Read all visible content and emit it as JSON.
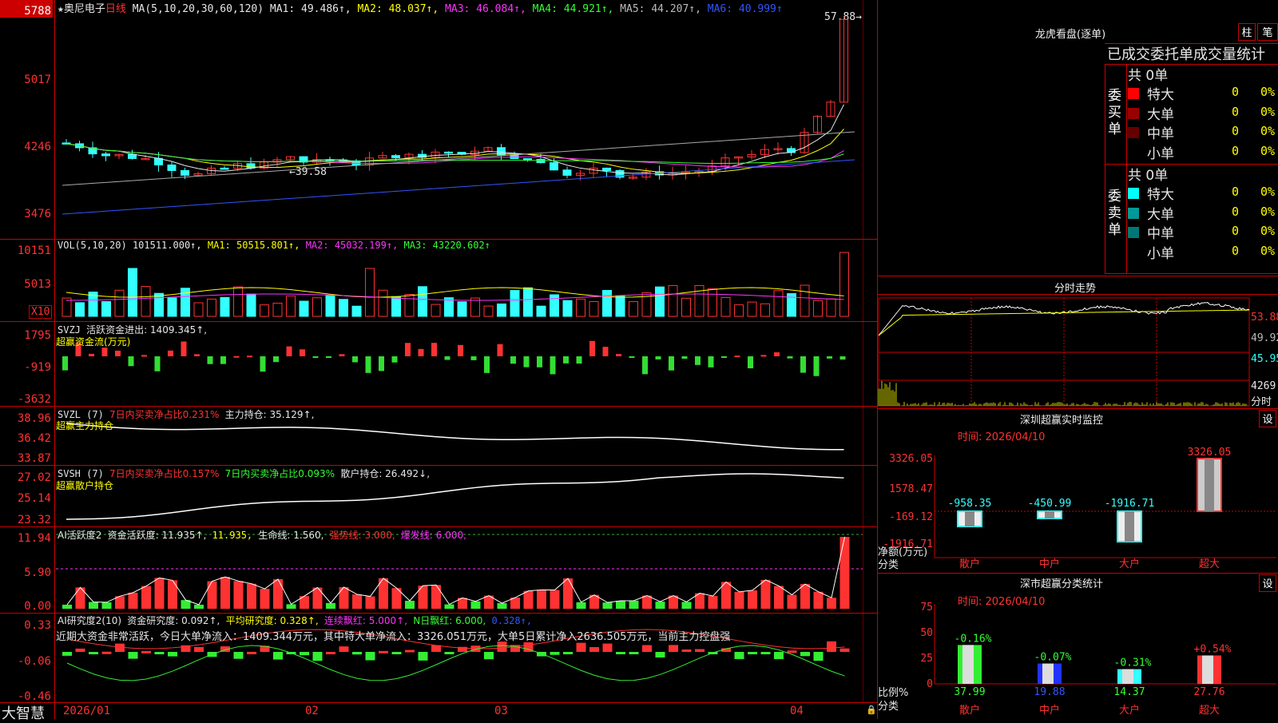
{
  "colors": {
    "up": "#ff3232",
    "down": "#33ffff",
    "grid": "#c00000",
    "ma1": "#e6e6e6",
    "ma2": "#ffff00",
    "ma3": "#ff33ff",
    "ma4": "#33ff33",
    "ma5": "#aaaaaa",
    "ma6": "#3355ff"
  },
  "main": {
    "star": "★",
    "stock_name": "奥尼电子",
    "period": "日线",
    "ma_label": "MA(5,10,20,30,60,120)",
    "ma1": "MA1: 49.486↑,",
    "ma2": "MA2: 48.037↑,",
    "ma3": "MA3: 46.084↑,",
    "ma4": "MA4: 44.921↑,",
    "ma5": "MA5: 44.207↑,",
    "ma6": "MA6: 40.999↑",
    "high_label": "57.88→",
    "low_label": "←39.58",
    "y_ticks": [
      "5788",
      "5017",
      "4246",
      "3476"
    ]
  },
  "vol": {
    "label": "VOL(5,10,20)",
    "value": "101511.000↑,",
    "ma1": "MA1: 50515.801↑,",
    "ma2": "MA2: 45032.199↑,",
    "ma3": "MA3: 43220.602↑",
    "y_ticks": [
      "10151",
      "5013"
    ],
    "unit_badge": "X10"
  },
  "svzj": {
    "label": "SVZJ",
    "line1": "活跃资金进出: 1409.345↑,",
    "line2": "超赢资金流(万元)",
    "y_ticks": [
      "1795",
      "-919",
      "-3632"
    ]
  },
  "svzl": {
    "label": "SVZL (7)",
    "a": "7日内买卖净占比0.231%",
    "b": "主力持仓: 35.129↑,",
    "line2": "超赢主力持仓",
    "y_ticks": [
      "38.96",
      "36.42",
      "33.87"
    ]
  },
  "svsh": {
    "label": "SVSH (7)",
    "a": "7日内买卖净占比0.157%",
    "b": "7日内买卖净占比0.093%",
    "c": "散户持仓: 26.492↓,",
    "line2": "超赢散户持仓",
    "y_ticks": [
      "27.02",
      "25.14",
      "23.32"
    ]
  },
  "ai1": {
    "label": "AI活跃度2",
    "a": "资金活跃度: 11.935↑,",
    "b": "11.935,",
    "c": "生命线: 1.560,",
    "d": "强势线: 3.000,",
    "e": "爆发线: 6.000,",
    "y_ticks": [
      "11.94",
      "5.90",
      "0.00"
    ]
  },
  "ai2": {
    "label": "AI研究度2(10)",
    "a": "资金研究度: 0.092↑,",
    "b": "平均研究度: 0.328↑,",
    "c": "连续飘红: 5.000↑,",
    "d": "N日飘红: 6.000,",
    "e": "0.328↑,",
    "comment": "近期大资金非常活跃，今日大单净流入：1409.344万元，其中特大单净流入：3326.051万元，大单5日累计净入2636.505万元，当前主力控盘强",
    "y_ticks": [
      "0.33",
      "-0.06",
      "-0.46"
    ]
  },
  "xaxis": {
    "brand": "大智慧",
    "dates": [
      "2026/01",
      "02",
      "03",
      "04"
    ]
  },
  "lhb": {
    "title": "龙虎看盘(逐单)",
    "btn1": "柱",
    "btn2": "笔",
    "header": "已成交委托单成交量统计",
    "buy_label": "委买单",
    "sell_label": "委卖单",
    "buy_total": "共 0单",
    "sell_total": "共 0单",
    "buy_rows": [
      {
        "name": "特大",
        "count": "0",
        "pct": "0%",
        "color": "#ff0000"
      },
      {
        "name": "大单",
        "count": "0",
        "pct": "0%",
        "color": "#990000"
      },
      {
        "name": "中单",
        "count": "0",
        "pct": "0%",
        "color": "#660000"
      },
      {
        "name": "小单",
        "count": "0",
        "pct": "0%",
        "color": ""
      }
    ],
    "sell_rows": [
      {
        "name": "特大",
        "count": "0",
        "pct": "0%",
        "color": "#00ffff"
      },
      {
        "name": "大单",
        "count": "0",
        "pct": "0%",
        "color": "#009999"
      },
      {
        "name": "中单",
        "count": "0",
        "pct": "0%",
        "color": "#007777"
      },
      {
        "name": "小单",
        "count": "0",
        "pct": "0%",
        "color": ""
      }
    ]
  },
  "fenshi": {
    "title": "分时走势",
    "y_ticks": [
      "53.88",
      "49.92",
      "45.95",
      "4269"
    ],
    "x_label": "分时"
  },
  "monitor": {
    "title": "深圳超赢实时监控",
    "btn": "设",
    "date": "时间: 2026/04/10",
    "y_ticks": [
      "3326.05",
      "1578.47",
      "-169.12",
      "-1916.71"
    ],
    "left_label1": "净额(万元)",
    "left_label2": "分类",
    "bars": [
      {
        "cat": "散户",
        "value": "-958.35"
      },
      {
        "cat": "中户",
        "value": "-450.99"
      },
      {
        "cat": "大户",
        "value": "-1916.71"
      },
      {
        "cat": "超大",
        "value": "3326.05"
      }
    ]
  },
  "stats": {
    "title": "深市超赢分类统计",
    "btn": "设",
    "date": "时间: 2026/04/10",
    "y_ticks": [
      "75",
      "50",
      "25",
      "0"
    ],
    "left_label1": "比例%",
    "left_label2": "分类",
    "bars": [
      {
        "cat": "散户",
        "value": "37.99",
        "change": "-0.16%"
      },
      {
        "cat": "中户",
        "value": "19.88",
        "change": "-0.07%"
      },
      {
        "cat": "大户",
        "value": "14.37",
        "change": "-0.31%"
      },
      {
        "cat": "超大",
        "value": "27.76",
        "change": "+0.54%"
      }
    ]
  }
}
